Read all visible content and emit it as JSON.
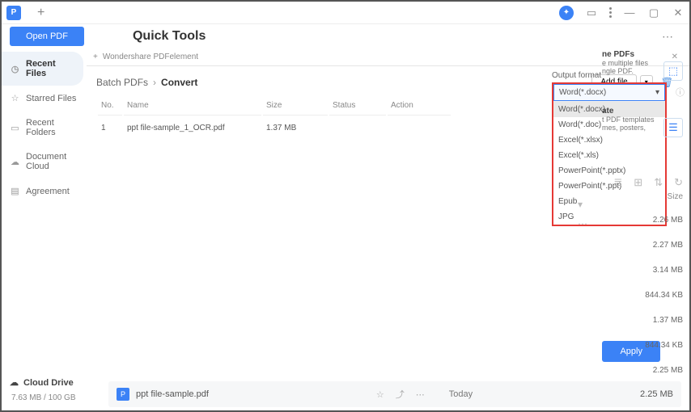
{
  "titlebar": {
    "tab_plus": "+"
  },
  "header": {
    "open_pdf": "Open PDF",
    "quick_tools": "Quick Tools"
  },
  "sidebar": {
    "items": [
      {
        "label": "Recent Files",
        "active": true,
        "icon": "clock"
      },
      {
        "label": "Starred Files",
        "active": false,
        "icon": "star"
      },
      {
        "label": "Recent Folders",
        "active": false,
        "icon": "folder"
      },
      {
        "label": "Document Cloud",
        "active": false,
        "icon": "cloud"
      },
      {
        "label": "Agreement",
        "active": false,
        "icon": "doc"
      }
    ],
    "cloud_drive": "Cloud Drive",
    "storage": "7.63 MB / 100 GB"
  },
  "subtab": {
    "label": "Wondershare PDFelement"
  },
  "batch": {
    "breadcrumb_root": "Batch PDFs",
    "breadcrumb_current": "Convert",
    "add_file": "Add file",
    "columns": {
      "no": "No.",
      "name": "Name",
      "size": "Size",
      "status": "Status",
      "action": "Action"
    },
    "rows": [
      {
        "no": "1",
        "name": "ppt file-sample_1_OCR.pdf",
        "size": "1.37 MB",
        "status": "",
        "action": ""
      }
    ]
  },
  "output": {
    "label": "Output format",
    "selected": "Word(*.docx)",
    "options": [
      "Word(*.docx)",
      "Word(*.doc)",
      "Excel(*.xlsx)",
      "Excel(*.xls)",
      "PowerPoint(*.pptx)",
      "PowerPoint(*.ppt)",
      "Epub",
      "JPG"
    ]
  },
  "right": {
    "card1_title": "ne PDFs",
    "card1_line1": "e multiple files",
    "card1_line2": "ngle PDF.",
    "card2_title": "ate",
    "card2_line1": "t PDF templates",
    "card2_line2": "mes, posters,",
    "size_header": "Size",
    "sizes": [
      "2.26 MB",
      "2.27 MB",
      "3.14 MB",
      "844.34 KB",
      "1.37 MB",
      "844.34 KB",
      "2.25 MB"
    ]
  },
  "apply": "Apply",
  "bottom": {
    "filename": "ppt file-sample.pdf",
    "date": "Today",
    "size": "2.25 MB"
  }
}
